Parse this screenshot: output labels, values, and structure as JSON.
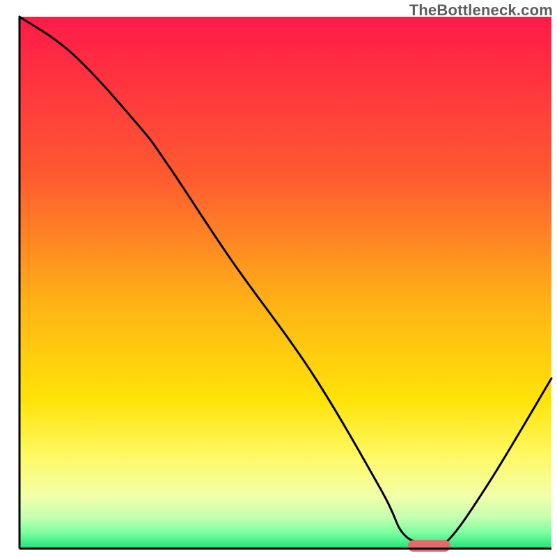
{
  "watermark": "TheBottleneck.com",
  "chart_data": {
    "type": "line",
    "title": "",
    "xlabel": "",
    "ylabel": "",
    "xlim": [
      0,
      100
    ],
    "ylim": [
      0,
      100
    ],
    "grid": false,
    "legend": false,
    "annotations": [],
    "background": {
      "type": "vertical-gradient",
      "stops": [
        {
          "offset": 0.0,
          "color": "#ff1a49"
        },
        {
          "offset": 0.3,
          "color": "#ff5a30"
        },
        {
          "offset": 0.55,
          "color": "#ffb615"
        },
        {
          "offset": 0.72,
          "color": "#ffe308"
        },
        {
          "offset": 0.82,
          "color": "#fff85e"
        },
        {
          "offset": 0.9,
          "color": "#f3ffa8"
        },
        {
          "offset": 0.94,
          "color": "#c7ffb0"
        },
        {
          "offset": 0.97,
          "color": "#7dffa0"
        },
        {
          "offset": 1.0,
          "color": "#1fe07a"
        }
      ]
    },
    "series": [
      {
        "name": "bottleneck-curve",
        "color": "#000000",
        "x": [
          0,
          10,
          22,
          28,
          40,
          55,
          68,
          72,
          76,
          80,
          88,
          100
        ],
        "y": [
          100,
          93,
          80,
          72,
          54,
          33,
          11,
          3,
          1,
          1,
          12,
          32
        ]
      }
    ],
    "marker": {
      "name": "optimal-range",
      "shape": "rounded-bar",
      "color": "#e26a6a",
      "x_start": 73,
      "x_end": 81,
      "y": 0.5,
      "height": 2.2
    },
    "frame": {
      "left": true,
      "bottom": true,
      "top": false,
      "right": false,
      "color": "#000000",
      "width": 3
    }
  }
}
